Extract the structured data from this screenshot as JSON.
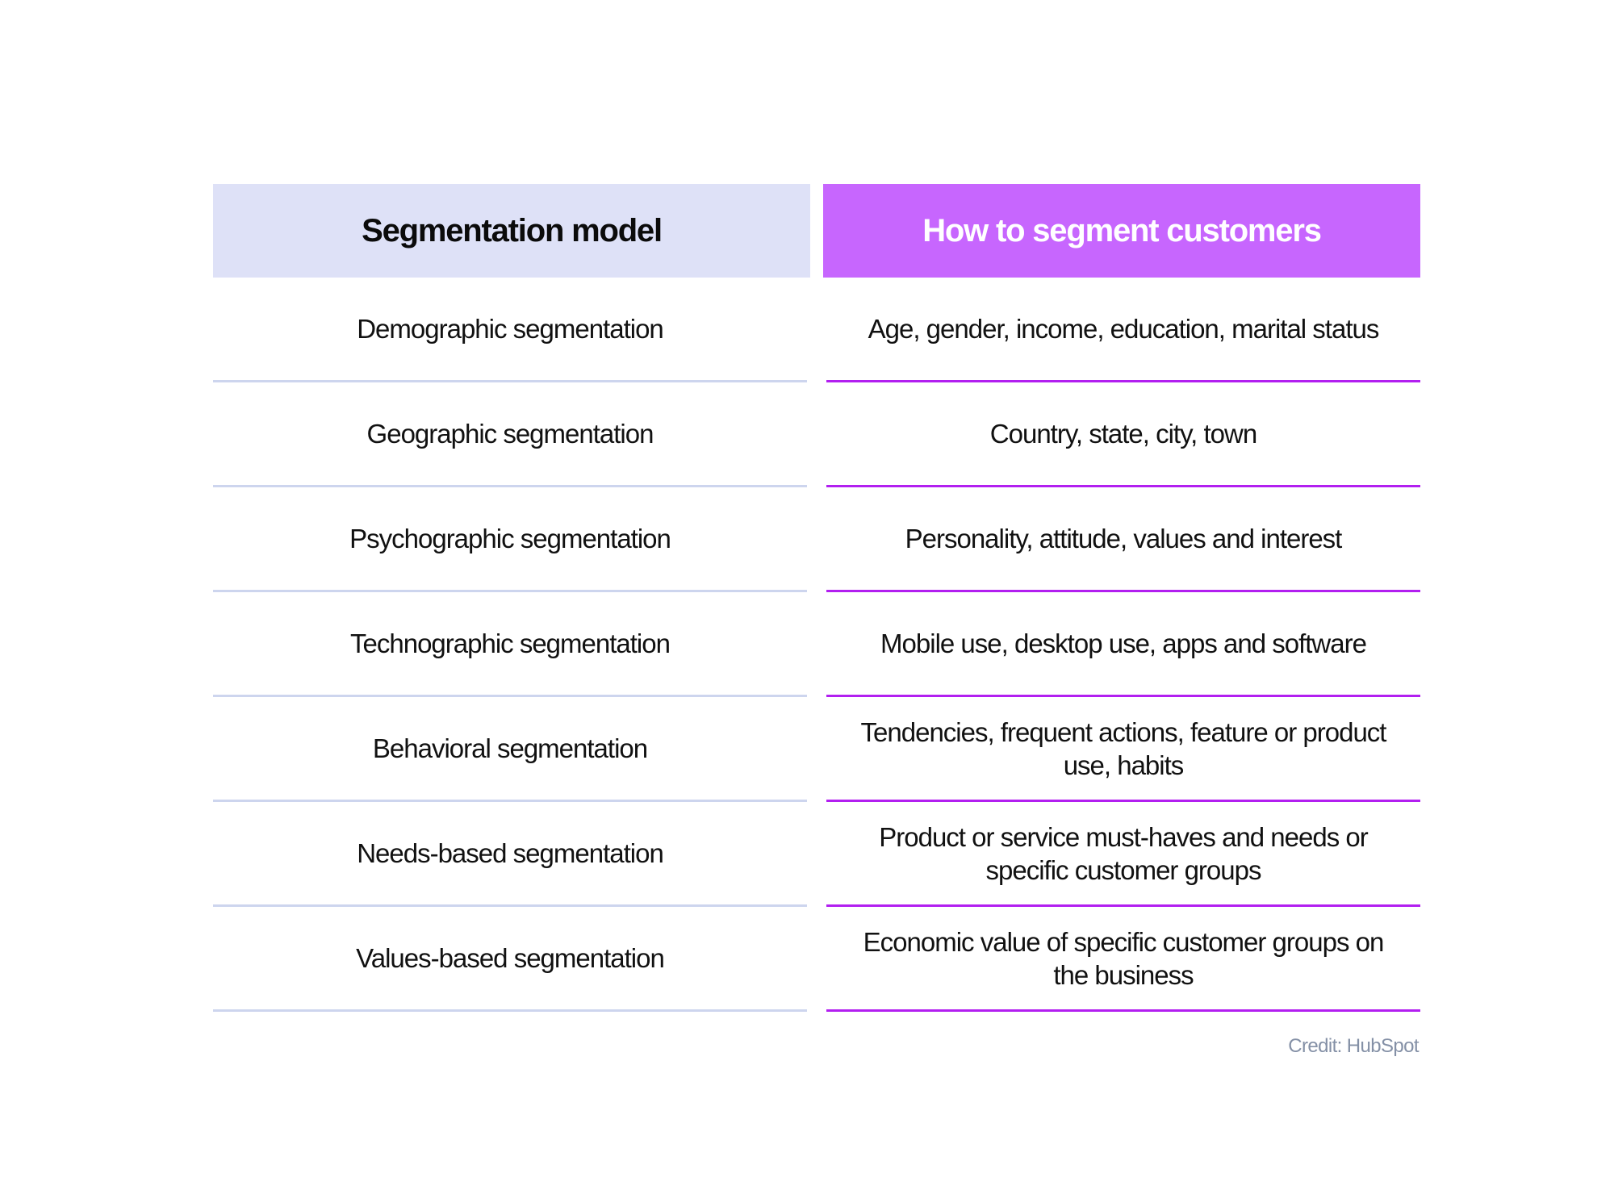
{
  "table": {
    "headers": {
      "model": "Segmentation model",
      "how": "How to segment customers"
    },
    "rows": [
      {
        "model": "Demographic segmentation",
        "how": "Age, gender, income, education, marital status"
      },
      {
        "model": "Geographic segmentation",
        "how": "Country, state, city, town"
      },
      {
        "model": "Psychographic segmentation",
        "how": "Personality, attitude, values and interest"
      },
      {
        "model": "Technographic segmentation",
        "how": "Mobile use, desktop use, apps and software"
      },
      {
        "model": "Behavioral segmentation",
        "how": "Tendencies, frequent actions, feature or product use, habits"
      },
      {
        "model": "Needs-based segmentation",
        "how": "Product or service must-haves and needs or specific customer groups"
      },
      {
        "model": "Values-based segmentation",
        "how": "Economic value of specific customer groups on the business"
      }
    ]
  },
  "credit": "Credit: HubSpot",
  "colors": {
    "left_header_bg": "#dee1f7",
    "right_header_bg": "#c766fe",
    "left_divider": "#cdd5ee",
    "right_divider": "#b21ff0",
    "credit_text": "#8490a6"
  }
}
